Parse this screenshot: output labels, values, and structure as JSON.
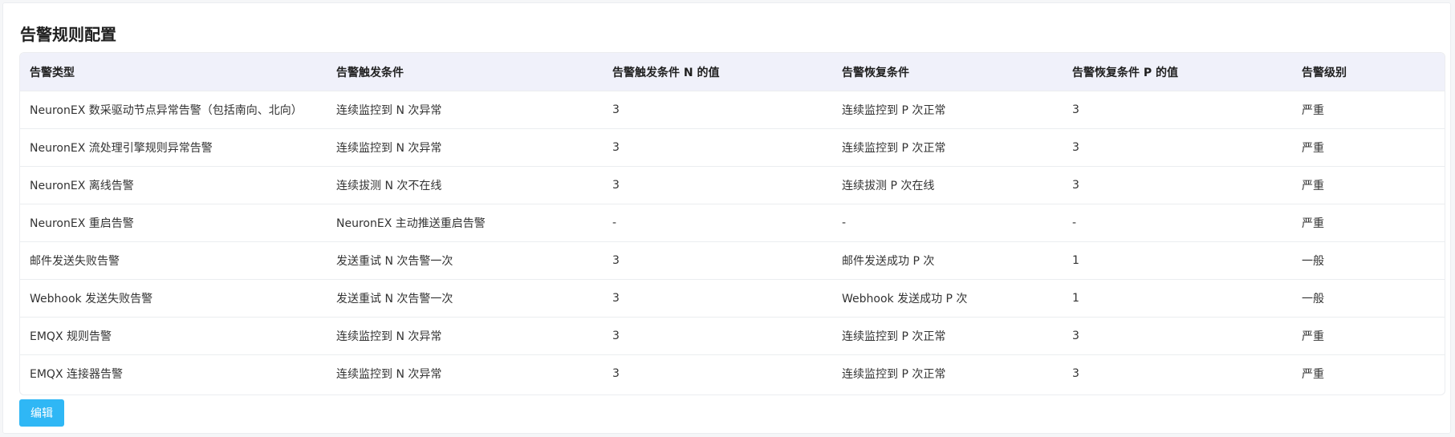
{
  "page": {
    "title": "告警规则配置"
  },
  "table": {
    "headers": [
      "告警类型",
      "告警触发条件",
      "告警触发条件 N 的值",
      "告警恢复条件",
      "告警恢复条件 P 的值",
      "告警级别"
    ],
    "rows": [
      [
        "NeuronEX 数采驱动节点异常告警（包括南向、北向）",
        "连续监控到 N 次异常",
        "3",
        "连续监控到 P 次正常",
        "3",
        "严重"
      ],
      [
        "NeuronEX 流处理引擎规则异常告警",
        "连续监控到 N 次异常",
        "3",
        "连续监控到 P 次正常",
        "3",
        "严重"
      ],
      [
        "NeuronEX 离线告警",
        "连续拔测 N 次不在线",
        "3",
        "连续拔测 P 次在线",
        "3",
        "严重"
      ],
      [
        "NeuronEX 重启告警",
        "NeuronEX 主动推送重启告警",
        "-",
        "-",
        "-",
        "严重"
      ],
      [
        "邮件发送失败告警",
        "发送重试 N 次告警一次",
        "3",
        "邮件发送成功 P 次",
        "1",
        "一般"
      ],
      [
        "Webhook 发送失败告警",
        "发送重试 N 次告警一次",
        "3",
        "Webhook 发送成功 P 次",
        "1",
        "一般"
      ],
      [
        "EMQX 规则告警",
        "连续监控到 N 次异常",
        "3",
        "连续监控到 P 次正常",
        "3",
        "严重"
      ],
      [
        "EMQX 连接器告警",
        "连续监控到 N 次异常",
        "3",
        "连续监控到 P 次正常",
        "3",
        "严重"
      ]
    ]
  },
  "actions": {
    "edit_label": "编辑"
  },
  "colors": {
    "header_bg": "#f0f1fa",
    "primary_button": "#2fb7f5",
    "border": "#ebedf0"
  }
}
